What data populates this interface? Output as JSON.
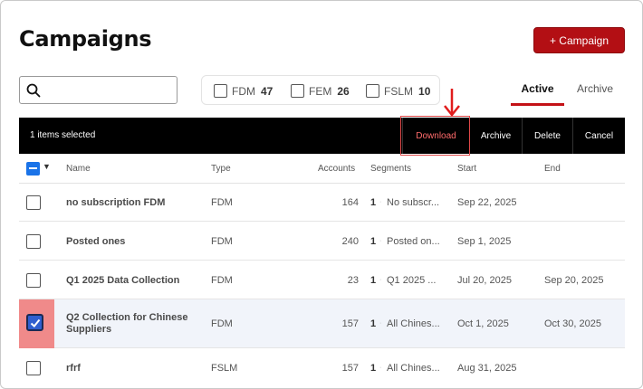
{
  "header": {
    "title": "Campaigns",
    "new_button": "+ Campaign"
  },
  "search": {
    "placeholder": "",
    "value": ""
  },
  "filters": [
    {
      "label": "FDM",
      "count": "47"
    },
    {
      "label": "FEM",
      "count": "26"
    },
    {
      "label": "FSLM",
      "count": "10"
    }
  ],
  "tabs": {
    "active": "Active",
    "archive": "Archive"
  },
  "action_bar": {
    "selected_text": "1 items selected",
    "download": "Download",
    "archive": "Archive",
    "delete": "Delete",
    "cancel": "Cancel"
  },
  "table": {
    "columns": [
      "Name",
      "Type",
      "Accounts",
      "Segments",
      "Start",
      "End"
    ],
    "rows": [
      {
        "name": "no subscription FDM",
        "type": "FDM",
        "accounts": "164",
        "seg_count": "1",
        "segment": "No subscr...",
        "start": "Sep 22, 2025",
        "end": "",
        "checked": false
      },
      {
        "name": "Posted ones",
        "type": "FDM",
        "accounts": "240",
        "seg_count": "1",
        "segment": "Posted on...",
        "start": "Sep 1, 2025",
        "end": "",
        "checked": false
      },
      {
        "name": "Q1 2025 Data Collection",
        "type": "FDM",
        "accounts": "23",
        "seg_count": "1",
        "segment": "Q1 2025 ...",
        "start": "Jul 20, 2025",
        "end": "Sep 20, 2025",
        "checked": false
      },
      {
        "name": "Q2 Collection for Chinese Suppliers",
        "type": "FDM",
        "accounts": "157",
        "seg_count": "1",
        "segment": "All Chines...",
        "start": "Oct 1, 2025",
        "end": "Oct 30, 2025",
        "checked": true
      },
      {
        "name": "rfrf",
        "type": "FSLM",
        "accounts": "157",
        "seg_count": "1",
        "segment": "All Chines...",
        "start": "Aug 31, 2025",
        "end": "",
        "checked": false
      }
    ]
  },
  "colors": {
    "brand": "#b30f14",
    "accent": "#c41117",
    "checkbox": "#1a73e8",
    "highlight": "#f08a8a"
  }
}
